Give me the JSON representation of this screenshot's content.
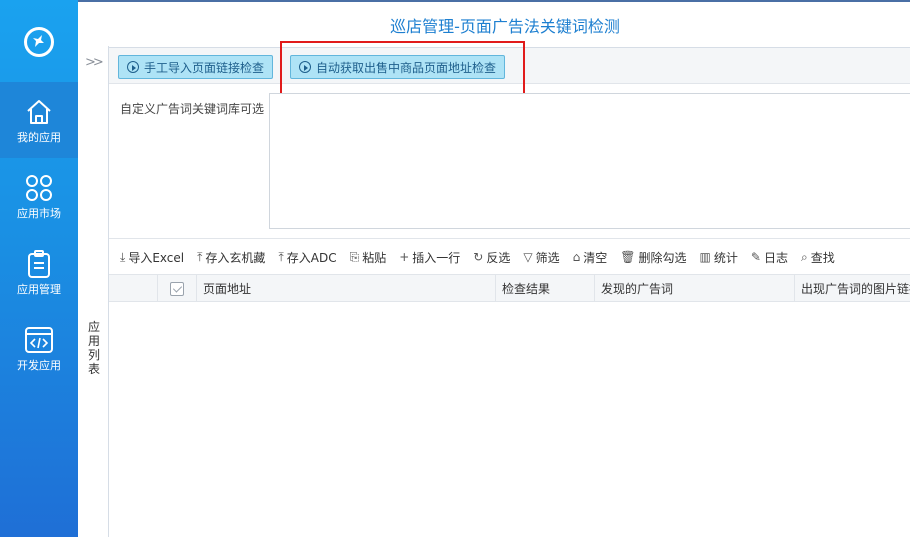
{
  "title": "巡店管理-页面广告法关键词检测",
  "sidebar": {
    "items": [
      {
        "label": "我的应用",
        "icon": "home-icon"
      },
      {
        "label": "应用市场",
        "icon": "grid-icon"
      },
      {
        "label": "应用管理",
        "icon": "clipboard-icon"
      },
      {
        "label": "开发应用",
        "icon": "code-window-icon"
      }
    ]
  },
  "strip": {
    "label": "应用列表",
    "chevron": ">>"
  },
  "actions": {
    "manual_import": "手工导入页面链接检查",
    "auto_fetch": "自动获取出售中商品页面地址检查"
  },
  "field": {
    "label": "自定义广告词关键词库可选",
    "value": ""
  },
  "toolbar": [
    {
      "icon": "import-icon",
      "glyph": "⤓",
      "label": "导入Excel"
    },
    {
      "icon": "upload-icon",
      "glyph": "⤒",
      "label": "存入玄机藏"
    },
    {
      "icon": "upload-icon",
      "glyph": "⤒",
      "label": "存入ADC"
    },
    {
      "icon": "paste-icon",
      "glyph": "⎘",
      "label": "粘贴"
    },
    {
      "icon": "plus-icon",
      "glyph": "+",
      "label": "插入一行"
    },
    {
      "icon": "invert-icon",
      "glyph": "↻",
      "label": "反选"
    },
    {
      "icon": "filter-icon",
      "glyph": "▽",
      "label": "筛选"
    },
    {
      "icon": "broom-icon",
      "glyph": "⌂",
      "label": "清空"
    },
    {
      "icon": "trash-icon",
      "glyph": "🗑",
      "label": "删除勾选"
    },
    {
      "icon": "stats-icon",
      "glyph": "▥",
      "label": "统计"
    },
    {
      "icon": "log-icon",
      "glyph": "✎",
      "label": "日志"
    },
    {
      "icon": "search-icon",
      "glyph": "⌕",
      "label": "查找"
    }
  ],
  "table": {
    "columns": [
      "页面地址",
      "检查结果",
      "发现的广告词",
      "出现广告词的图片链接"
    ]
  },
  "colors": {
    "accent": "#1d7fd0",
    "highlight": "#e11b1b",
    "button_bg": "#aee3f6"
  }
}
